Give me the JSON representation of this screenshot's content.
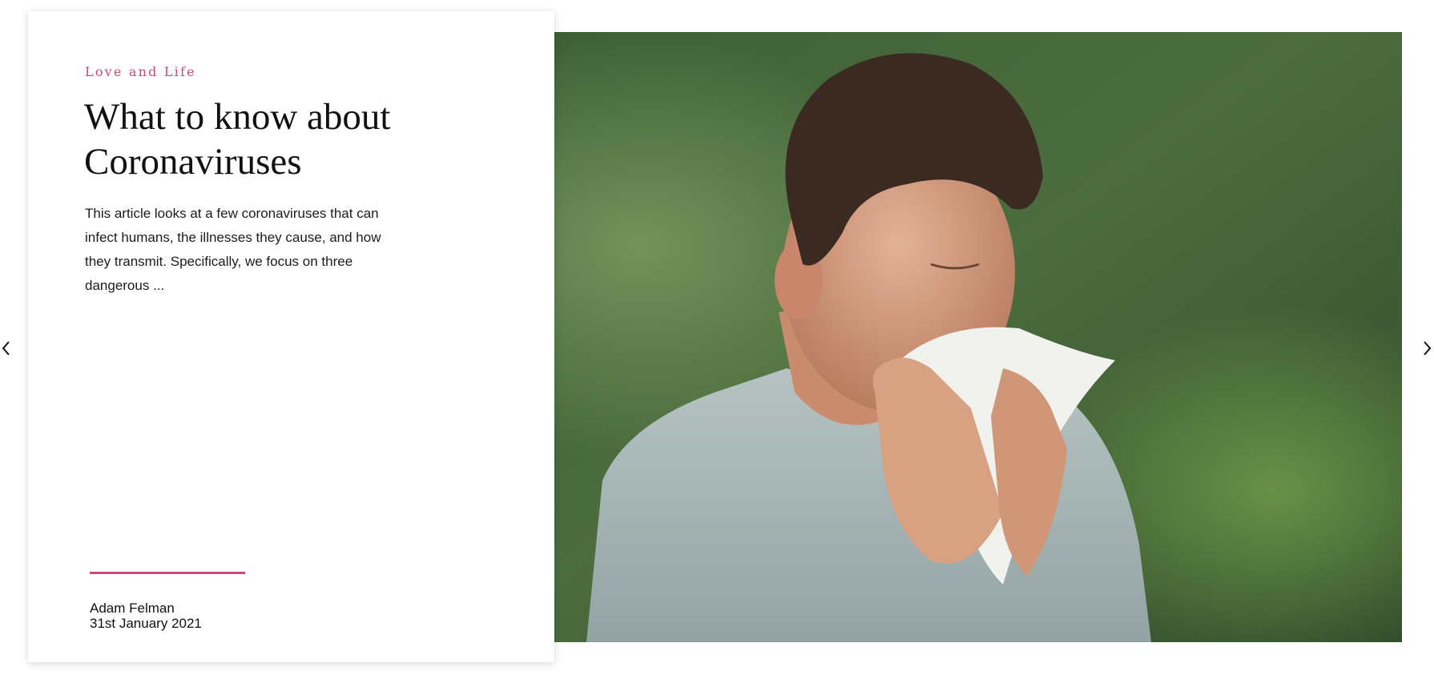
{
  "article": {
    "category": "Love and Life",
    "title": "What to know about Coronaviruses",
    "excerpt": "This article looks at a few coronaviruses that can infect humans, the illnesses they cause, and how they transmit. Specifically, we focus on three dangerous ...",
    "author": "Adam Felman",
    "date": "31st January 2021"
  },
  "colors": {
    "accent": "#d1467a",
    "text": "#111111",
    "background": "#ffffff"
  },
  "icons": {
    "prev": "chevron-left-icon",
    "next": "chevron-right-icon"
  }
}
